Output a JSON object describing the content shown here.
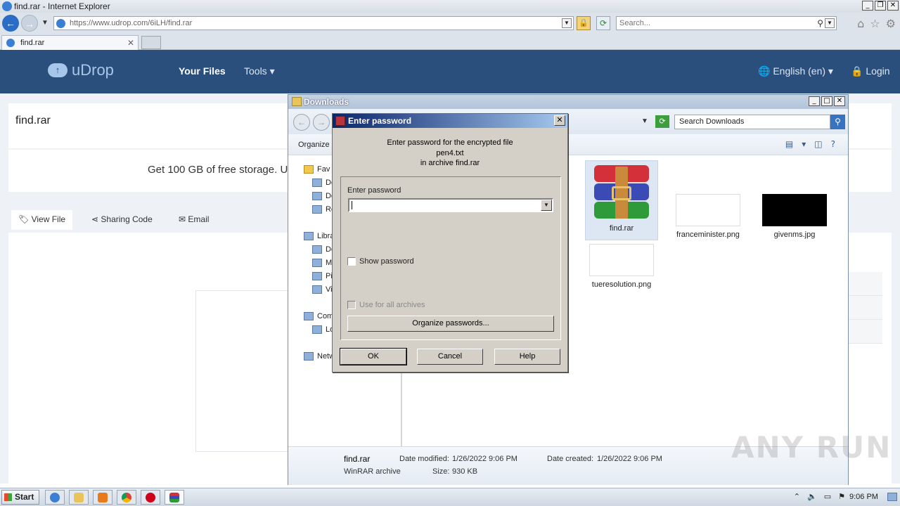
{
  "browser": {
    "window_title": "find.rar - Internet Explorer",
    "url_prefix": "https://www.",
    "url_domain": "udrop.com",
    "url_path": "/6iLH/find.rar",
    "search_placeholder": "Search...",
    "tab_label": "find.rar"
  },
  "site": {
    "logo": "uDrop",
    "nav_your_files": "Your Files",
    "nav_tools": "Tools",
    "language": "English (en)",
    "login": "Login",
    "file_name": "find.rar",
    "promo": "Get 100 GB of free storage. U",
    "tabs": [
      "View File",
      "Sharing Code",
      "Email"
    ]
  },
  "explorer": {
    "title": "Downloads",
    "search_placeholder": "Search Downloads",
    "organize": "Organize",
    "nav_items": [
      "Fav",
      "De",
      "Do",
      "Re",
      "Libra",
      "Do",
      "M",
      "Pi",
      "Vi",
      "Com",
      "Lo",
      "Netw"
    ],
    "files": [
      {
        "name": "find.rar"
      },
      {
        "name": "franceminister.png"
      },
      {
        "name": "givenms.jpg"
      },
      {
        "name": "tueresolution.png"
      }
    ],
    "details": {
      "name": "find.rar",
      "type": "WinRAR archive",
      "date_modified_label": "Date modified:",
      "date_modified": "1/26/2022 9:06 PM",
      "date_created_label": "Date created:",
      "date_created": "1/26/2022 9:06 PM",
      "size_label": "Size:",
      "size": "930 KB"
    }
  },
  "dialog": {
    "title": "Enter password",
    "line1": "Enter password for the encrypted file",
    "line2": "pen4.txt",
    "line3": "in archive find.rar",
    "field_label": "Enter password",
    "show_password": "Show password",
    "use_for_all": "Use for all archives",
    "organize_passwords": "Organize passwords...",
    "ok": "OK",
    "cancel": "Cancel",
    "help": "Help"
  },
  "taskbar": {
    "start": "Start",
    "clock": "9:06 PM"
  },
  "watermark": "ANY RUN"
}
